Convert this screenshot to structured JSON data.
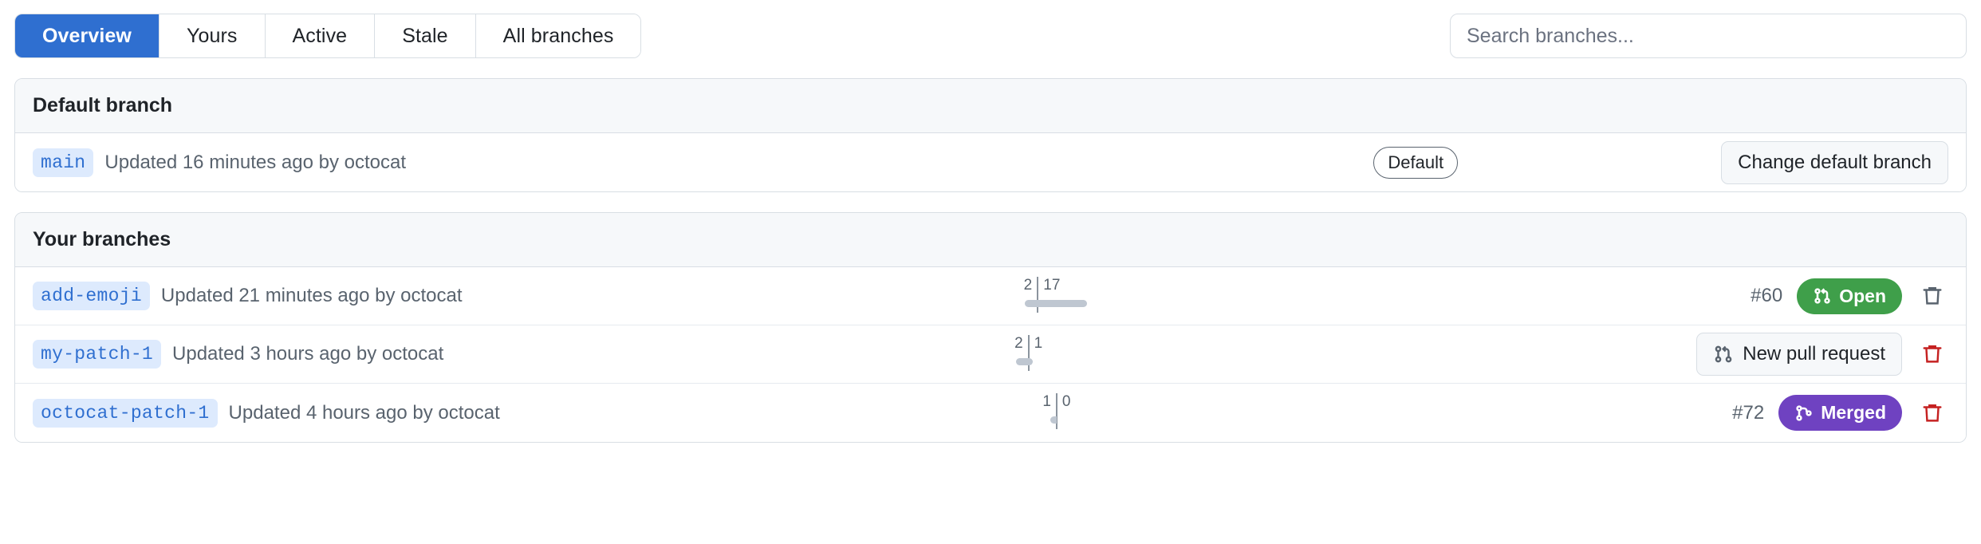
{
  "tabs": [
    {
      "label": "Overview",
      "active": true
    },
    {
      "label": "Yours",
      "active": false
    },
    {
      "label": "Active",
      "active": false
    },
    {
      "label": "Stale",
      "active": false
    },
    {
      "label": "All branches",
      "active": false
    }
  ],
  "search": {
    "placeholder": "Search branches...",
    "value": ""
  },
  "default_section": {
    "heading": "Default branch",
    "branch": "main",
    "meta": "Updated 16 minutes ago by octocat",
    "default_pill": "Default",
    "change_button": "Change default branch"
  },
  "your_section": {
    "heading": "Your branches",
    "rows": [
      {
        "branch": "add-emoji",
        "meta": "Updated 21 minutes ago by octocat",
        "ahead": "2",
        "behind": "17",
        "pr_number": "#60",
        "status_label": "Open",
        "status_kind": "open",
        "status_icon": "pull-request-icon",
        "action": null,
        "delete_icon": "trash-icon",
        "delete_color": "#59636e"
      },
      {
        "branch": "my-patch-1",
        "meta": "Updated 3 hours ago by octocat",
        "ahead": "2",
        "behind": "1",
        "pr_number": "",
        "status_label": "",
        "status_kind": "",
        "status_icon": "",
        "action": "New pull request",
        "action_icon": "pull-request-icon",
        "delete_icon": "trash-icon",
        "delete_color": "#c52121"
      },
      {
        "branch": "octocat-patch-1",
        "meta": "Updated 4 hours ago by octocat",
        "ahead": "1",
        "behind": "0",
        "pr_number": "#72",
        "status_label": "Merged",
        "status_kind": "merged",
        "status_icon": "git-merge-icon",
        "action": null,
        "delete_icon": "trash-icon",
        "delete_color": "#c52121"
      }
    ]
  },
  "colors": {
    "accent_blue": "#2f6fd0",
    "open_green": "#3f9f4a",
    "merged_purple": "#6f42c1",
    "delete_red": "#c52121",
    "chip_bg": "#ddeafd",
    "panel_head_bg": "#f6f8fa",
    "border": "#d8dee4"
  }
}
